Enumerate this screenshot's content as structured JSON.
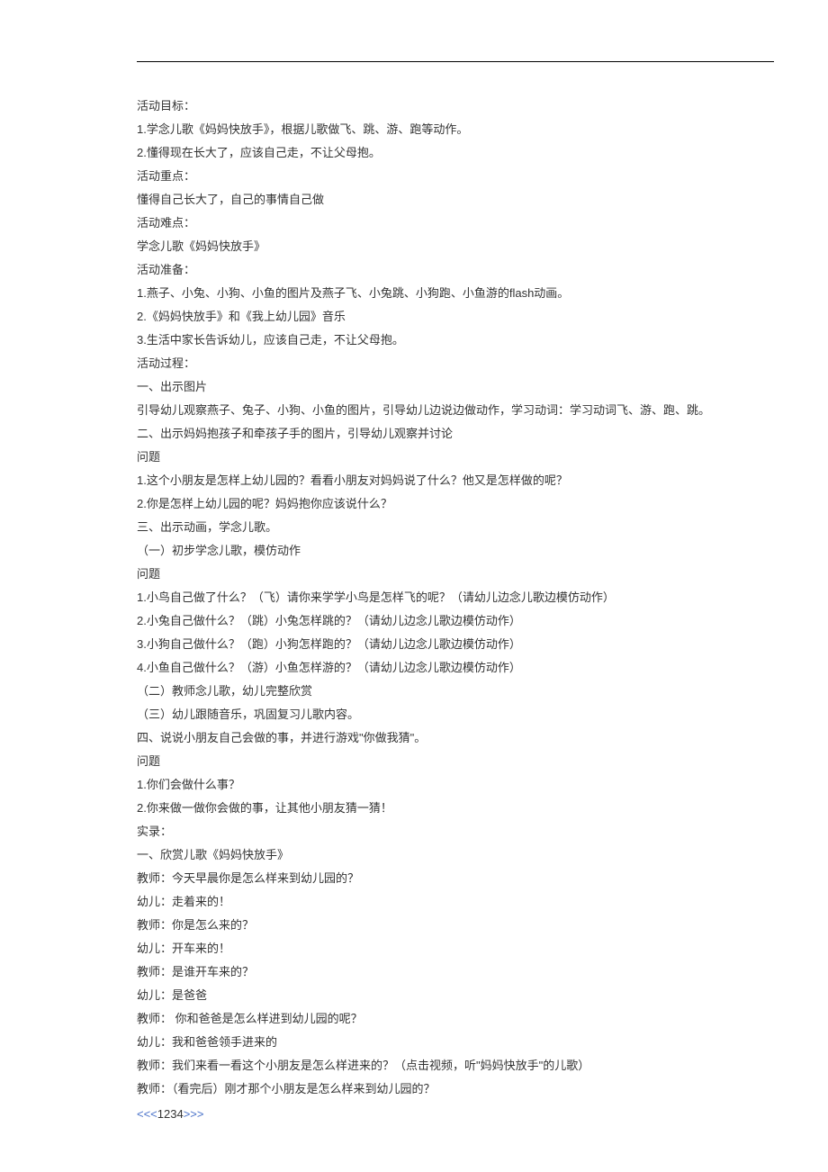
{
  "lines": [
    "活动目标：",
    "1.学念儿歌《妈妈快放手》，根据儿歌做飞、跳、游、跑等动作。",
    "2.懂得现在长大了，应该自己走，不让父母抱。",
    "活动重点：",
    "懂得自己长大了，自己的事情自己做",
    "活动难点：",
    "学念儿歌《妈妈快放手》",
    "活动准备：",
    "1.燕子、小兔、小狗、小鱼的图片及燕子飞、小兔跳、小狗跑、小鱼游的flash动画。",
    "2.《妈妈快放手》和《我上幼儿园》音乐",
    "3.生活中家长告诉幼儿，应该自己走，不让父母抱。",
    "活动过程：",
    "一、出示图片",
    "引导幼儿观察燕子、兔子、小狗、小鱼的图片，引导幼儿边说边做动作，学习动词：学习动词飞、游、跑、跳。",
    "二、出示妈妈抱孩子和牵孩子手的图片，引导幼儿观察并讨论",
    "问题",
    "1.这个小朋友是怎样上幼儿园的？看看小朋友对妈妈说了什么？他又是怎样做的呢？",
    "2.你是怎样上幼儿园的呢？妈妈抱你应该说什么？",
    "三、出示动画，学念儿歌。",
    "（一）初步学念儿歌，模仿动作",
    "问题",
    "1.小鸟自己做了什么？（飞）请你来学学小鸟是怎样飞的呢？（请幼儿边念儿歌边模仿动作）",
    "2.小兔自己做什么？（跳）小兔怎样跳的？（请幼儿边念儿歌边模仿动作）",
    "3.小狗自己做什么？（跑）小狗怎样跑的？（请幼儿边念儿歌边模仿动作）",
    "4.小鱼自己做什么？（游）小鱼怎样游的？（请幼儿边念儿歌边模仿动作）",
    "（二）教师念儿歌，幼儿完整欣赏",
    "（三）幼儿跟随音乐，巩固复习儿歌内容。",
    "四、说说小朋友自己会做的事，并进行游戏\"你做我猜\"。",
    "问题",
    "1.你们会做什么事？",
    "2.你来做一做你会做的事，让其他小朋友猜一猜！",
    "实录：",
    "一、欣赏儿歌《妈妈快放手》",
    "教师：今天早晨你是怎么样来到幼儿园的？",
    "幼儿：走着来的！",
    "教师：你是怎么来的？",
    "幼儿：开车来的！",
    "教师：是谁开车来的？",
    "幼儿：是爸爸",
    "教师：  你和爸爸是怎么样进到幼儿园的呢？",
    "幼儿：我和爸爸领手进来的",
    "教师：我们来看一看这个小朋友是怎么样进来的？（点击视频，听\"妈妈快放手\"的儿歌）",
    "教师：（看完后）刚才那个小朋友是怎么样来到幼儿园的？"
  ],
  "pagination": {
    "left_arrows": "<<<",
    "numbers": "1234",
    "right_arrows": ">>>"
  }
}
